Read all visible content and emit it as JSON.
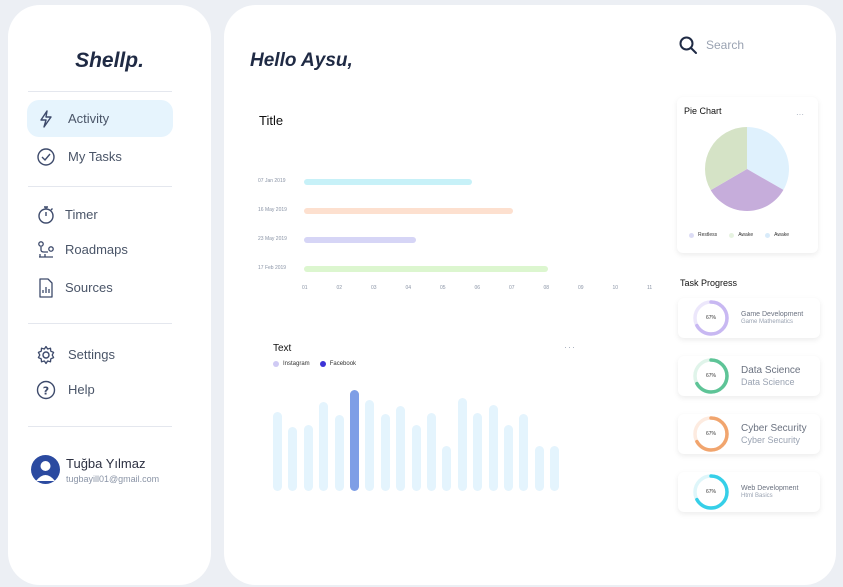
{
  "sidebar": {
    "logo": "Shellp.",
    "nav": [
      {
        "label": "Activity",
        "icon": "bolt-icon"
      },
      {
        "label": "My Tasks",
        "icon": "check-circle-icon"
      },
      {
        "label": "Timer",
        "icon": "stopwatch-icon"
      },
      {
        "label": "Roadmaps",
        "icon": "route-icon"
      },
      {
        "label": "Sources",
        "icon": "document-icon"
      },
      {
        "label": "Settings",
        "icon": "gear-icon"
      },
      {
        "label": "Help",
        "icon": "help-icon"
      }
    ],
    "active_item": "Activity",
    "user": {
      "name": "Tuğba Yılmaz",
      "email": "tugbayill01@gmail.com"
    }
  },
  "main": {
    "greeting": "Hello Aysu,",
    "gantt": {
      "title": "Title",
      "rows": [
        {
          "date": "07 Jan 2019",
          "color": "#c7f1f8",
          "end": 5.8
        },
        {
          "date": "16 May 2019",
          "color": "#fde0cf",
          "end": 7.0
        },
        {
          "date": "23 May 2019",
          "color": "#d6d5f6",
          "end": 4.2
        },
        {
          "date": "17 Feb 2019",
          "color": "#dcf6cf",
          "end": 8.0
        }
      ],
      "ticks": [
        "01",
        "02",
        "03",
        "04",
        "05",
        "06",
        "07",
        "08",
        "09",
        "10",
        "11"
      ]
    },
    "bar_chart": {
      "title": "Text",
      "menu": "···",
      "legend": [
        {
          "label": "Instagram",
          "color": "#cfcaf4"
        },
        {
          "label": "Facebook",
          "color": "#3d33d6"
        }
      ],
      "values": [
        78,
        63,
        65,
        88,
        75,
        100,
        90,
        76,
        84,
        65,
        77,
        45,
        92,
        77,
        85,
        65,
        76,
        45,
        45
      ],
      "highlight_index": 5,
      "bar_color": "#e4f4fd",
      "highlight_color": "#7e9ee6"
    }
  },
  "search": {
    "placeholder": "Search"
  },
  "pie": {
    "title": "Pie Chart",
    "menu": "···",
    "slices": [
      {
        "label": "Restless",
        "value": 33.3,
        "color": "#dff1fd"
      },
      {
        "label": "Awake",
        "value": 33.3,
        "color": "#c6addb"
      },
      {
        "label": "Awake",
        "value": 33.4,
        "color": "#d5e3c6"
      }
    ],
    "legend_dot_colors": [
      "#dcdcf5",
      "#e7f3e1",
      "#d8ebfa"
    ]
  },
  "task_progress": {
    "title": "Task Progress",
    "items": [
      {
        "title": "Game Development",
        "subtitle": "Game Mathematics",
        "percent": "67%",
        "value": 67,
        "color": "#c8b8f2",
        "track": "#ece7fb",
        "size": "small"
      },
      {
        "title": "Data Science",
        "subtitle": "Data Science",
        "percent": "67%",
        "value": 67,
        "color": "#5ec497",
        "track": "#e0f4ea",
        "size": "large"
      },
      {
        "title": "Cyber Security",
        "subtitle": "Cyber Security",
        "percent": "67%",
        "value": 67,
        "color": "#f1a56e",
        "track": "#fdebe0",
        "size": "large"
      },
      {
        "title": "Web Development",
        "subtitle": "Html Basics",
        "percent": "67%",
        "value": 67,
        "color": "#36cfe8",
        "track": "#def6fa",
        "size": "small"
      }
    ]
  }
}
